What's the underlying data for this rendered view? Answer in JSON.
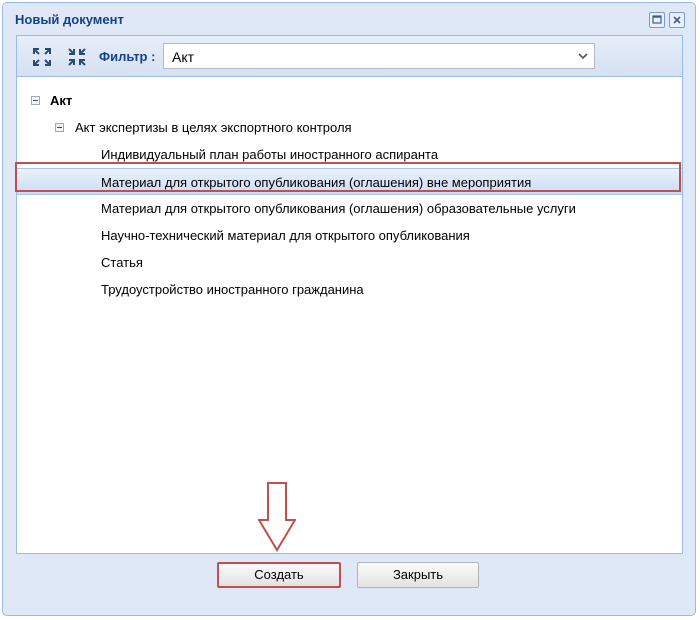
{
  "window": {
    "title": "Новый документ",
    "tools": [
      "maximize-icon",
      "close-icon"
    ]
  },
  "toolbar": {
    "expand_icon": "expand-all-icon",
    "collapse_icon": "collapse-all-icon",
    "filter_label": "Фильтр :",
    "filter_value": "Акт"
  },
  "tree": {
    "root": {
      "label": "Акт",
      "expanded": true
    },
    "group": {
      "label": "Акт экспертизы в целях экспортного контроля",
      "expanded": true
    },
    "leaves": [
      {
        "label": "Индивидуальный план работы иностранного аспиранта"
      },
      {
        "label": "Материал для открытого опубликования (оглашения) вне мероприятия",
        "selected": true
      },
      {
        "label": "Материал для открытого опубликования (оглашения) образовательные услуги"
      },
      {
        "label": "Научно-технический материал для открытого опубликования"
      },
      {
        "label": "Статья"
      },
      {
        "label": "Трудоустройство иностранного гражданина"
      }
    ]
  },
  "buttons": {
    "create": "Создать",
    "close": "Закрыть"
  },
  "colors": {
    "accent": "#15428b",
    "highlight": "#c0504d",
    "window_bg": "#dfe8f6"
  }
}
